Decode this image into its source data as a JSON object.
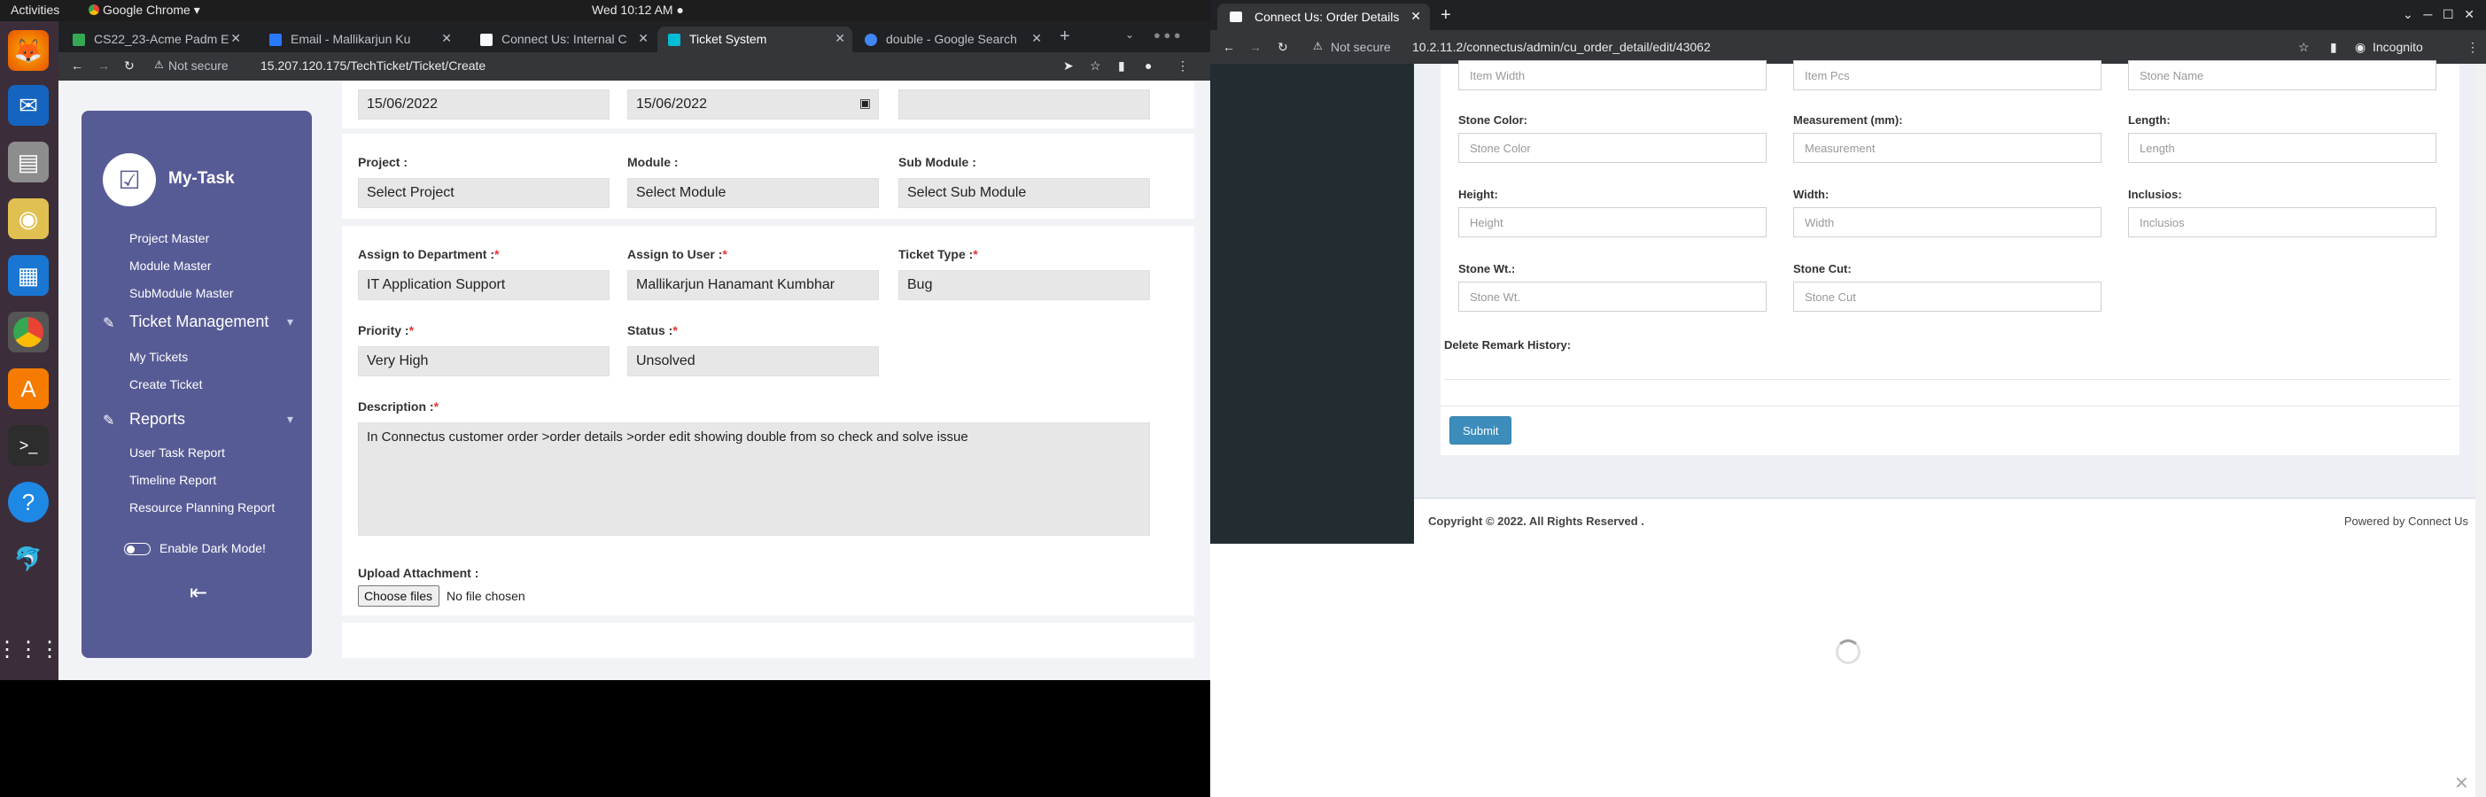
{
  "os": {
    "activities": "Activities",
    "browser_name": "Google Chrome",
    "clock": "Wed 10:12 AM"
  },
  "dock_icons": [
    "firefox-icon",
    "thunderbird-icon",
    "files-icon",
    "rhythmbox-icon",
    "writer-icon",
    "chrome-icon",
    "software-icon",
    "terminal-icon",
    "help-icon",
    "app-icon",
    "apps-grid-icon"
  ],
  "left_browser": {
    "tabs": [
      {
        "label": "CS22_23-Acme Padm E",
        "color": "#34a853"
      },
      {
        "label": "Email - Mallikarjun Ku",
        "color": "#2979ff"
      },
      {
        "label": "Connect Us: Internal C",
        "color": "#f8f9fa"
      },
      {
        "label": "Ticket System",
        "color": "#00bcd4"
      },
      {
        "label": "double - Google Search",
        "color": "#4285f4"
      }
    ],
    "security": "Not secure",
    "url": "15.207.120.175/TechTicket/Ticket/Create"
  },
  "sidebar": {
    "logo_text": "My-Task",
    "items": [
      "Project Master",
      "Module Master",
      "SubModule Master"
    ],
    "ticket_heading": "Ticket Management",
    "ticket_items": [
      "My Tickets",
      "Create Ticket"
    ],
    "reports_heading": "Reports",
    "report_items": [
      "User Task Report",
      "Timeline Report",
      "Resource Planning Report"
    ],
    "dark_mode": "Enable Dark Mode!"
  },
  "form": {
    "date1": "15/06/2022",
    "date2": "15/06/2022",
    "project_label": "Project :",
    "project_value": "Select Project",
    "module_label": "Module :",
    "module_value": "Select Module",
    "submodule_label": "Sub Module :",
    "submodule_value": "Select Sub Module",
    "dept_label": "Assign to Department :",
    "dept_value": "IT Application Support",
    "user_label": "Assign to User :",
    "user_value": "Mallikarjun Hanamant Kumbhar",
    "type_label": "Ticket Type :",
    "type_value": "Bug",
    "priority_label": "Priority :",
    "priority_value": "Very High",
    "status_label": "Status :",
    "status_value": "Unsolved",
    "desc_label": "Description :",
    "desc_value": "In Connectus customer order >order details >order edit showing double from so check and solve issue",
    "upload_label": "Upload Attachment :",
    "choose_files": "Choose files",
    "no_file": "No file chosen",
    "required_mark": "*"
  },
  "right_browser": {
    "tab_label": "Connect Us: Order Details",
    "security": "Not secure",
    "url": "10.2.11.2/connectus/admin/cu_order_detail/edit/43062",
    "incognito": "Incognito"
  },
  "order_form": {
    "top_placeholders": [
      "Item Width",
      "Item Pcs",
      "Stone Name"
    ],
    "stone_color_label": "Stone Color:",
    "stone_color_ph": "Stone Color",
    "measurement_label": "Measurement (mm):",
    "measurement_ph": "Measurement",
    "length_label": "Length:",
    "length_ph": "Length",
    "height_label": "Height:",
    "height_ph": "Height",
    "width_label": "Width:",
    "width_ph": "Width",
    "inclusios_label": "Inclusios:",
    "inclusios_ph": "Inclusios",
    "stone_wt_label": "Stone Wt.:",
    "stone_wt_ph": "Stone Wt.",
    "stone_cut_label": "Stone Cut:",
    "stone_cut_ph": "Stone Cut",
    "delete_remark": "Delete Remark History:",
    "submit": "Submit",
    "copyright": "Copyright © 2022. All Rights Reserved .",
    "powered": "Powered by Connect Us"
  }
}
